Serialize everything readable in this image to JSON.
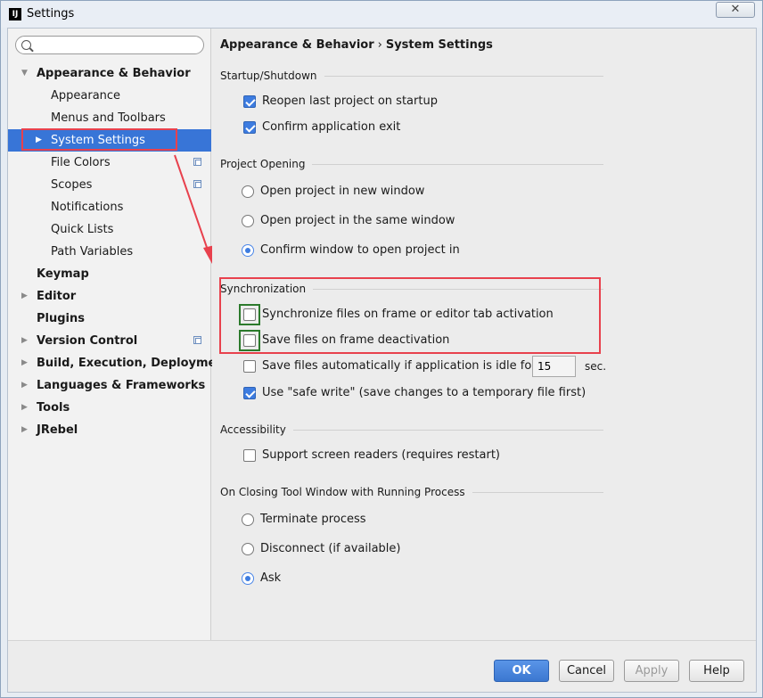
{
  "window": {
    "title": "Settings",
    "app_icon_text": "IJ",
    "close_glyph": "✕"
  },
  "search": {
    "value": "",
    "placeholder": ""
  },
  "tree": [
    {
      "label": "Appearance & Behavior",
      "bold": true,
      "arrow": "▼",
      "indent": 0
    },
    {
      "label": "Appearance",
      "indent": 1
    },
    {
      "label": "Menus and Toolbars",
      "indent": 1
    },
    {
      "label": "System Settings",
      "indent": 1,
      "arrow": "▶",
      "selected": true
    },
    {
      "label": "File Colors",
      "indent": 1,
      "copy_icon": true
    },
    {
      "label": "Scopes",
      "indent": 1,
      "copy_icon": true
    },
    {
      "label": "Notifications",
      "indent": 1
    },
    {
      "label": "Quick Lists",
      "indent": 1
    },
    {
      "label": "Path Variables",
      "indent": 1
    },
    {
      "label": "Keymap",
      "bold": true,
      "indent": 0
    },
    {
      "label": "Editor",
      "bold": true,
      "arrow": "▶",
      "indent": 0
    },
    {
      "label": "Plugins",
      "bold": true,
      "indent": 0
    },
    {
      "label": "Version Control",
      "bold": true,
      "arrow": "▶",
      "indent": 0,
      "copy_icon": true
    },
    {
      "label": "Build, Execution, Deployment",
      "bold": true,
      "arrow": "▶",
      "indent": 0
    },
    {
      "label": "Languages & Frameworks",
      "bold": true,
      "arrow": "▶",
      "indent": 0
    },
    {
      "label": "Tools",
      "bold": true,
      "arrow": "▶",
      "indent": 0
    },
    {
      "label": "JRebel",
      "bold": true,
      "arrow": "▶",
      "indent": 0
    }
  ],
  "breadcrumb": {
    "parent": "Appearance & Behavior",
    "separator": "›",
    "current": "System Settings"
  },
  "sections": {
    "startup": {
      "title": "Startup/Shutdown",
      "reopen": {
        "label": "Reopen last project on startup",
        "checked": true
      },
      "confirm_exit": {
        "label": "Confirm application exit",
        "checked": true
      }
    },
    "project_opening": {
      "title": "Project Opening",
      "new_window": {
        "label": "Open project in new window",
        "checked": false
      },
      "same_window": {
        "label": "Open project in the same window",
        "checked": false
      },
      "confirm_window": {
        "label": "Confirm window to open project in",
        "checked": true
      }
    },
    "sync": {
      "title": "Synchronization",
      "sync_frame": {
        "label": "Synchronize files on frame or editor tab activation",
        "checked": false
      },
      "save_deactivation": {
        "label": "Save files on frame deactivation",
        "checked": false
      },
      "save_idle": {
        "label": "Save files automatically if application is idle for",
        "checked": false,
        "value": "15",
        "unit": "sec."
      },
      "safe_write": {
        "label": "Use \"safe write\" (save changes to a temporary file first)",
        "checked": true
      }
    },
    "accessibility": {
      "title": "Accessibility",
      "screen_readers": {
        "label": "Support screen readers (requires restart)",
        "checked": false
      }
    },
    "closing": {
      "title": "On Closing Tool Window with Running Process",
      "terminate": {
        "label": "Terminate process",
        "checked": false
      },
      "disconnect": {
        "label": "Disconnect (if available)",
        "checked": false
      },
      "ask": {
        "label": "Ask",
        "checked": true
      }
    }
  },
  "buttons": {
    "ok": "OK",
    "cancel": "Cancel",
    "apply": "Apply",
    "help": "Help"
  },
  "colors": {
    "selection": "#3875d7",
    "highlight_red": "#e8414d",
    "highlight_green": "#2c7a2c",
    "accent": "#3d7ce0"
  }
}
